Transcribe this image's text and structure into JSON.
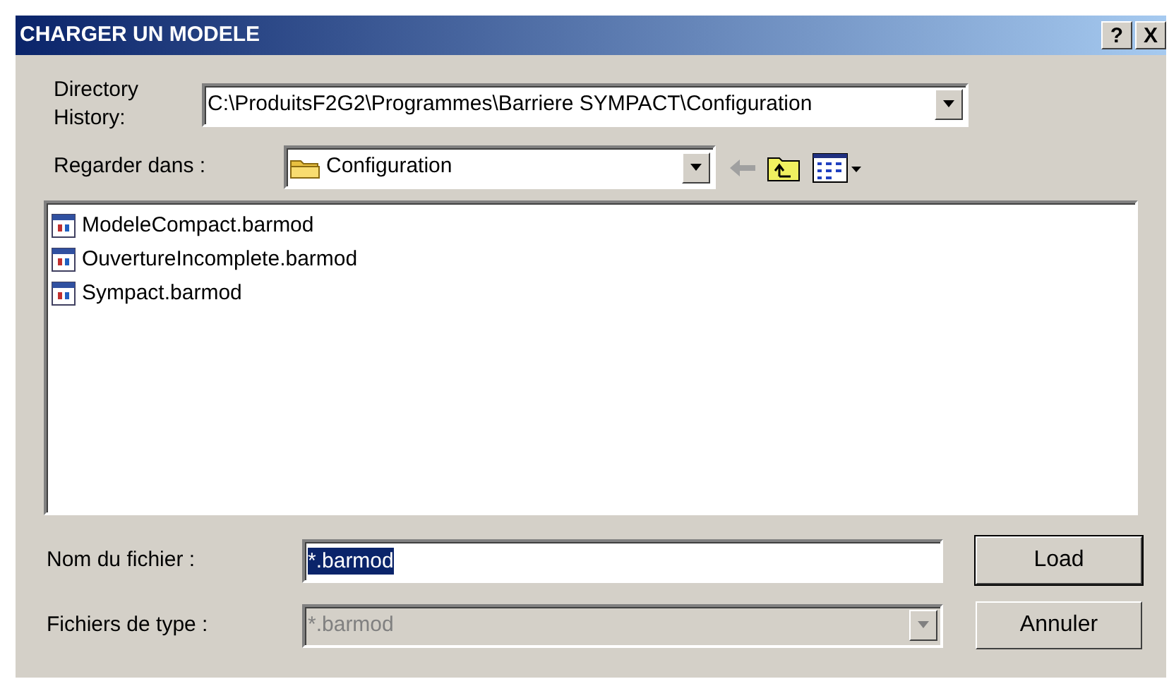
{
  "window": {
    "title": "CHARGER UN MODELE",
    "title_buttons": [
      "?",
      "X"
    ]
  },
  "directory_history": {
    "label": "Directory History:",
    "value": "C:\\ProduitsF2G2\\Programmes\\Barriere SYMPACT\\Configuration"
  },
  "look_in": {
    "label": "Regarder dans :",
    "value": "Configuration"
  },
  "files": [
    {
      "name": "ModeleCompact.barmod"
    },
    {
      "name": "OuvertureIncomplete.barmod"
    },
    {
      "name": "Sympact.barmod"
    }
  ],
  "file_name": {
    "label": "Nom du fichier :",
    "value": "*.barmod",
    "selected": true
  },
  "file_type": {
    "label": "Fichiers de type :",
    "value": "*.barmod",
    "disabled": true
  },
  "buttons": [
    {
      "label": "Load",
      "default": true
    },
    {
      "label": "Annuler",
      "default": false
    }
  ]
}
